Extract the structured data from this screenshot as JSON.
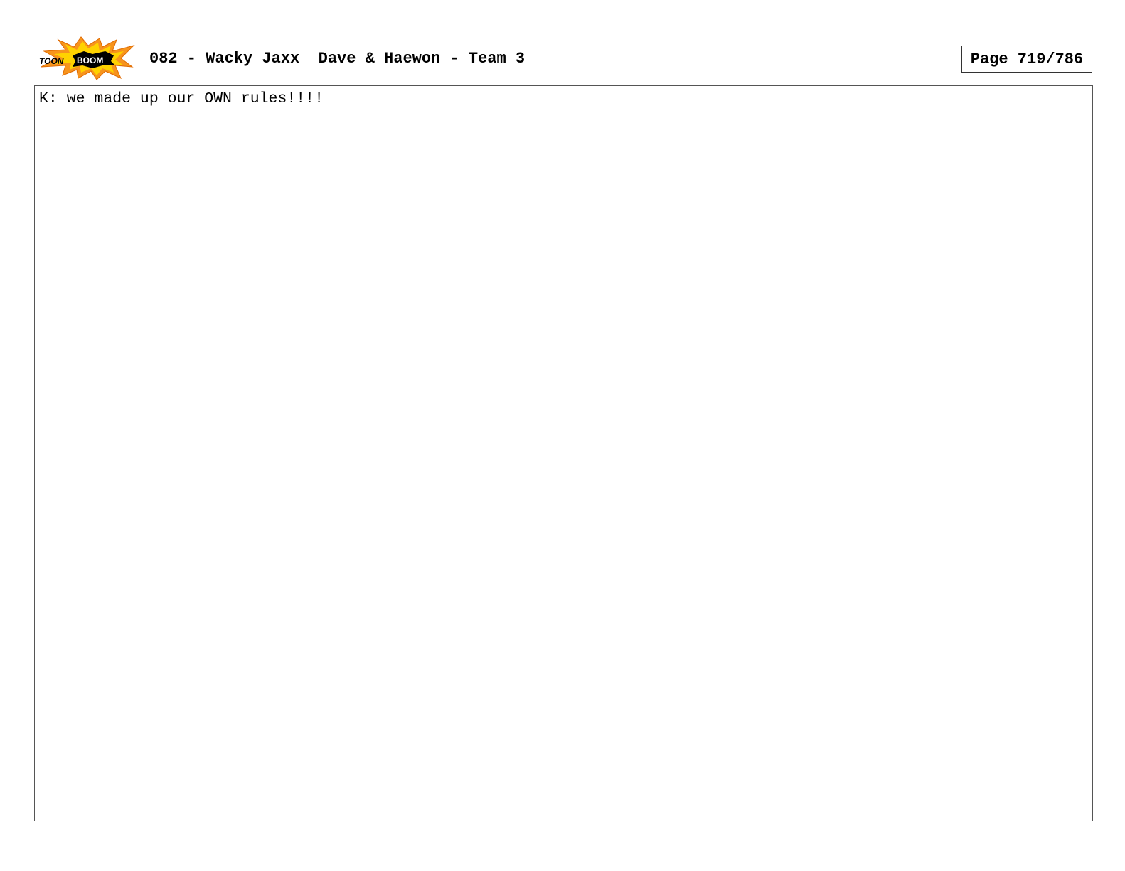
{
  "header": {
    "logo_text": "TOON BOOM",
    "title": "082 - Wacky Jaxx  Dave & Haewon - Team 3",
    "page_label": "Page 719/786"
  },
  "panel": {
    "dialogue": "K: we made up our OWN rules!!!!"
  },
  "colors": {
    "logo_burst_outer": "#f7941d",
    "logo_burst_inner": "#ffd200",
    "logo_core": "#000000",
    "border": "#555555"
  }
}
